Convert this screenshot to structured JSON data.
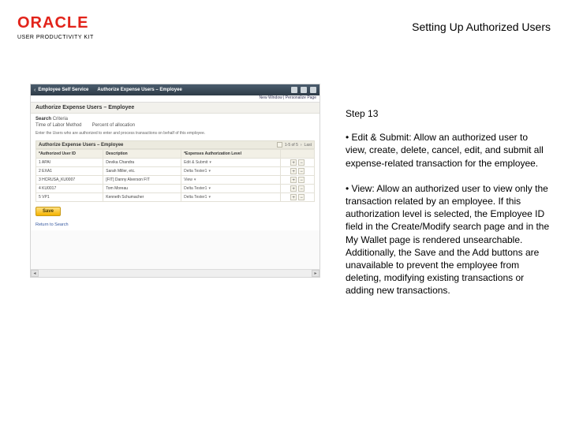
{
  "brand": {
    "name": "ORACLE",
    "subtitle": "USER PRODUCTIVITY KIT"
  },
  "doc_title": "Setting Up Authorized Users",
  "instruction": {
    "step": "Step 13",
    "p1": "• Edit & Submit: Allow an authorized user to view, create, delete, cancel, edit, and submit all  expense-related transaction for the employee.",
    "p2": "• View: Allow an authorized user to view only the transaction related by an employee. If this authorization level is selected, the Employee ID field in the Create/Modify search page and in the My Wallet page is rendered unsearchable. Additionally, the Save and the Add buttons are unavailable to prevent the employee from deleting, modifying existing transactions or adding new transactions."
  },
  "app": {
    "topbar": {
      "back": "‹",
      "breadcrumb": "Employee Self Service",
      "page_title": "Authorize Expense Users – Employee",
      "links": "New Window  |  Personalize Page"
    },
    "subheader": "Authorize Expense Users – Employee",
    "search": {
      "label": "Search",
      "criteria_lbl": "Criteria",
      "time_lbl": "Time of Labor Method",
      "time_val": "Percent of allocation",
      "desc": "Enter the Users who are authorized to enter and process transactions on behalf of this employee."
    },
    "grid": {
      "title": "Authorize Expense Users – Employee",
      "nav": "1-5 of 5",
      "nav_last": "Last",
      "columns": [
        "*Authorized User ID",
        "Description",
        "*Expenses Authorization Level",
        ""
      ],
      "rows": [
        {
          "c0": "1 APAI",
          "c1": "Devika Chandra",
          "c2": "Edit & Submit"
        },
        {
          "c0": "2 EXA1",
          "c1": "Sarah Miller, etc.",
          "c2": "Delta Tester1"
        },
        {
          "c0": "3 HCRUSA_KU0007",
          "c1": "[FIT] Danny Alverson FIT",
          "c2": "View"
        },
        {
          "c0": "4 KU0017",
          "c1": "Tom Moreau",
          "c2": "Delta Tester1"
        },
        {
          "c0": "5 VP1",
          "c1": "Kenneth Schumacher",
          "c2": "Delta Tester1"
        }
      ]
    },
    "save": "Save",
    "return": "Return to Search"
  }
}
